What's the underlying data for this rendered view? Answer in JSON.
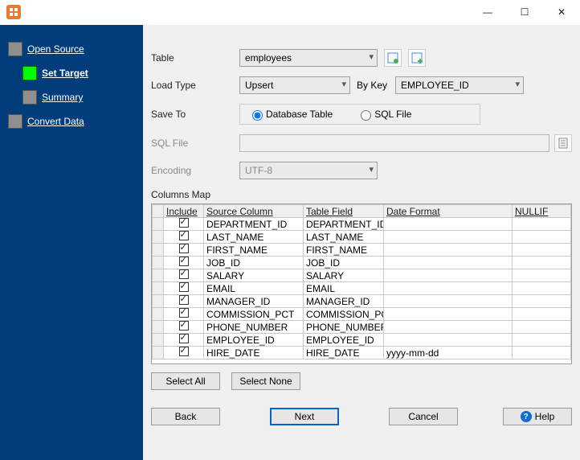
{
  "window": {
    "minimize": "—",
    "maximize": "☐",
    "close": "✕"
  },
  "nav": {
    "open_source": "Open Source",
    "set_target": "Set Target",
    "summary": "Summary",
    "convert_data": "Convert Data"
  },
  "form": {
    "table_label": "Table",
    "table_value": "employees",
    "load_type_label": "Load Type",
    "load_type_value": "Upsert",
    "by_key_label": "By Key",
    "by_key_value": "EMPLOYEE_ID",
    "save_to_label": "Save To",
    "save_to_db": "Database Table",
    "save_to_sql": "SQL File",
    "sql_file_label": "SQL File",
    "sql_file_value": "",
    "encoding_label": "Encoding",
    "encoding_value": "UTF-8",
    "columns_map_label": "Columns Map"
  },
  "grid": {
    "headers": {
      "include": "Include",
      "source_column": "Source Column",
      "table_field": "Table Field",
      "date_format": "Date Format",
      "nullif": "NULLIF"
    },
    "rows": [
      {
        "include": true,
        "source": "DEPARTMENT_ID",
        "field": "DEPARTMENT_ID",
        "date_format": "",
        "nullif": ""
      },
      {
        "include": true,
        "source": "LAST_NAME",
        "field": "LAST_NAME",
        "date_format": "",
        "nullif": ""
      },
      {
        "include": true,
        "source": "FIRST_NAME",
        "field": "FIRST_NAME",
        "date_format": "",
        "nullif": ""
      },
      {
        "include": true,
        "source": "JOB_ID",
        "field": "JOB_ID",
        "date_format": "",
        "nullif": ""
      },
      {
        "include": true,
        "source": "SALARY",
        "field": "SALARY",
        "date_format": "",
        "nullif": ""
      },
      {
        "include": true,
        "source": "EMAIL",
        "field": "EMAIL",
        "date_format": "",
        "nullif": ""
      },
      {
        "include": true,
        "source": "MANAGER_ID",
        "field": "MANAGER_ID",
        "date_format": "",
        "nullif": ""
      },
      {
        "include": true,
        "source": "COMMISSION_PCT",
        "field": "COMMISSION_PCT",
        "date_format": "",
        "nullif": ""
      },
      {
        "include": true,
        "source": "PHONE_NUMBER",
        "field": "PHONE_NUMBER",
        "date_format": "",
        "nullif": ""
      },
      {
        "include": true,
        "source": "EMPLOYEE_ID",
        "field": "EMPLOYEE_ID",
        "date_format": "",
        "nullif": ""
      },
      {
        "include": true,
        "source": "HIRE_DATE",
        "field": "HIRE_DATE",
        "date_format": "yyyy-mm-dd",
        "nullif": ""
      }
    ]
  },
  "buttons": {
    "select_all": "Select All",
    "select_none": "Select None",
    "back": "Back",
    "next": "Next",
    "cancel": "Cancel",
    "help": "Help"
  }
}
